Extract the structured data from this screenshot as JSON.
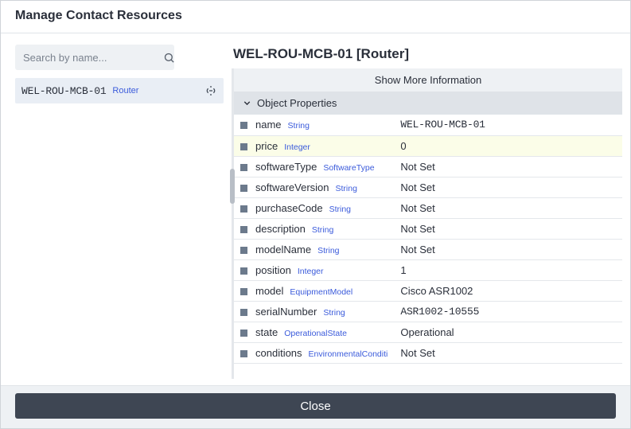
{
  "header": {
    "title": "Manage Contact Resources"
  },
  "sidebar": {
    "search_placeholder": "Search by name...",
    "result": {
      "name": "WEL-ROU-MCB-01",
      "type": "Router"
    }
  },
  "detail": {
    "title": "WEL-ROU-MCB-01 [Router]",
    "show_more": "Show More Information",
    "section_label": "Object Properties",
    "properties": [
      {
        "key": "name",
        "type": "String",
        "value": "WEL-ROU-MCB-01",
        "mono": true,
        "hl": false
      },
      {
        "key": "price",
        "type": "Integer",
        "value": "0",
        "mono": false,
        "hl": true
      },
      {
        "key": "softwareType",
        "type": "SoftwareType",
        "value": "Not Set",
        "mono": false,
        "hl": false
      },
      {
        "key": "softwareVersion",
        "type": "String",
        "value": "Not Set",
        "mono": false,
        "hl": false
      },
      {
        "key": "purchaseCode",
        "type": "String",
        "value": "Not Set",
        "mono": false,
        "hl": false
      },
      {
        "key": "description",
        "type": "String",
        "value": "Not Set",
        "mono": false,
        "hl": false
      },
      {
        "key": "modelName",
        "type": "String",
        "value": "Not Set",
        "mono": false,
        "hl": false
      },
      {
        "key": "position",
        "type": "Integer",
        "value": "1",
        "mono": false,
        "hl": false
      },
      {
        "key": "model",
        "type": "EquipmentModel",
        "value": "Cisco ASR1002",
        "mono": false,
        "hl": false
      },
      {
        "key": "serialNumber",
        "type": "String",
        "value": "ASR1002-10555",
        "mono": true,
        "hl": false
      },
      {
        "key": "state",
        "type": "OperationalState",
        "value": "Operational",
        "mono": false,
        "hl": false
      },
      {
        "key": "conditions",
        "type": "EnvironmentalConditi",
        "value": "Not Set",
        "mono": false,
        "hl": false
      }
    ]
  },
  "footer": {
    "close_label": "Close"
  }
}
